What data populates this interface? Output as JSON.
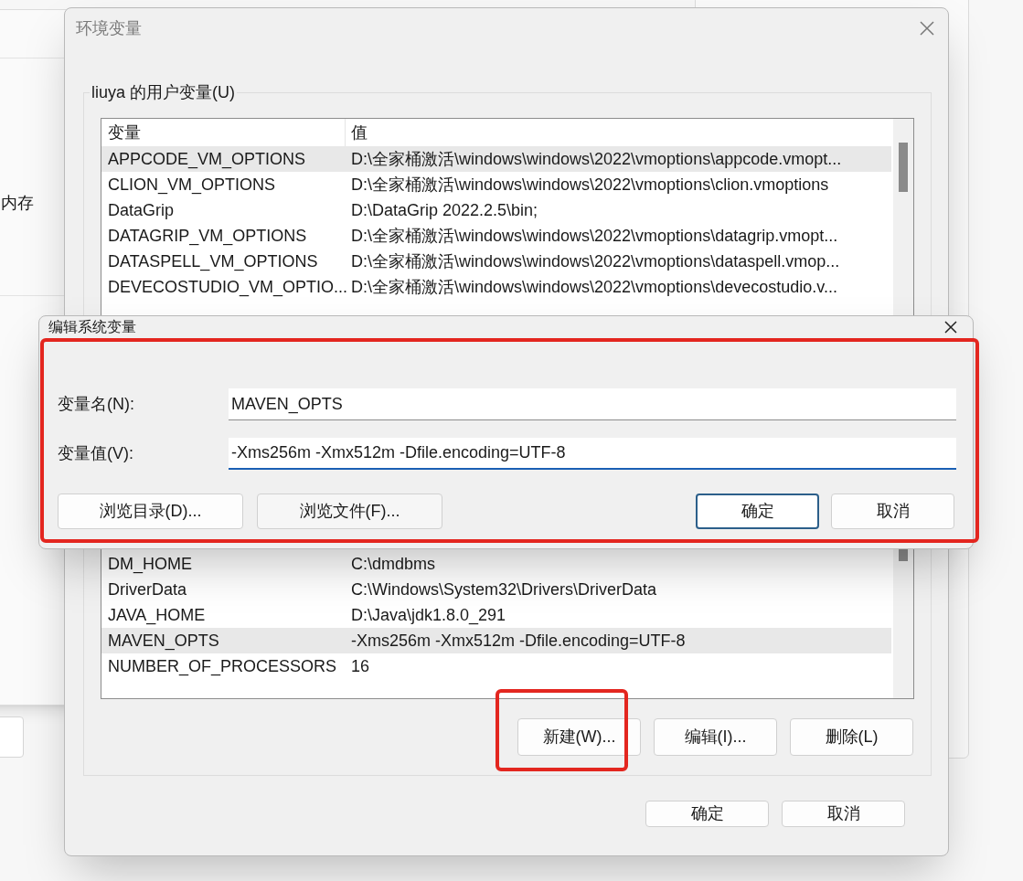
{
  "background_window": {
    "text": "内存"
  },
  "window": {
    "title": "环境变量"
  },
  "user_variables": {
    "label": "liuya 的用户变量(U)",
    "columns": [
      "变量",
      "值"
    ],
    "rows": [
      {
        "name": "APPCODE_VM_OPTIONS",
        "value": "D:\\全家桶激活\\windows\\windows\\2022\\vmoptions\\appcode.vmopt...",
        "selected": true
      },
      {
        "name": "CLION_VM_OPTIONS",
        "value": "D:\\全家桶激活\\windows\\windows\\2022\\vmoptions\\clion.vmoptions",
        "selected": false
      },
      {
        "name": "DataGrip",
        "value": "D:\\DataGrip 2022.2.5\\bin;",
        "selected": false
      },
      {
        "name": "DATAGRIP_VM_OPTIONS",
        "value": "D:\\全家桶激活\\windows\\windows\\2022\\vmoptions\\datagrip.vmopt...",
        "selected": false
      },
      {
        "name": "DATASPELL_VM_OPTIONS",
        "value": "D:\\全家桶激活\\windows\\windows\\2022\\vmoptions\\dataspell.vmop...",
        "selected": false
      },
      {
        "name": "DEVECOSTUDIO_VM_OPTIO...",
        "value": "D:\\全家桶激活\\windows\\windows\\2022\\vmoptions\\devecostudio.v...",
        "selected": false
      }
    ]
  },
  "system_variables": {
    "rows": [
      {
        "name": "DM_HOME",
        "value": "C:\\dmdbms",
        "selected": false
      },
      {
        "name": "DriverData",
        "value": "C:\\Windows\\System32\\Drivers\\DriverData",
        "selected": false
      },
      {
        "name": "JAVA_HOME",
        "value": "D:\\Java\\jdk1.8.0_291",
        "selected": false
      },
      {
        "name": "MAVEN_OPTS",
        "value": "-Xms256m -Xmx512m -Dfile.encoding=UTF-8",
        "selected": true
      },
      {
        "name": "NUMBER_OF_PROCESSORS",
        "value": "16",
        "selected": false
      }
    ],
    "buttons": [
      "新建(W)...",
      "编辑(I)...",
      "删除(L)"
    ]
  },
  "buttons": [
    {
      "label": "确定",
      "default": false
    },
    {
      "label": "取消",
      "default": false
    }
  ],
  "edit_dialog": {
    "title": "编辑系统变量",
    "fields": [
      {
        "label": "变量名(N):",
        "value": "MAVEN_OPTS",
        "focused": false
      },
      {
        "label": "变量值(V):",
        "value": "-Xms256m -Xmx512m -Dfile.encoding=UTF-8",
        "focused": true
      }
    ],
    "left_buttons": [
      "浏览目录(D)...",
      "浏览文件(F)..."
    ],
    "buttons": [
      {
        "label": "确定",
        "default": true
      },
      {
        "label": "取消",
        "default": false
      }
    ]
  }
}
